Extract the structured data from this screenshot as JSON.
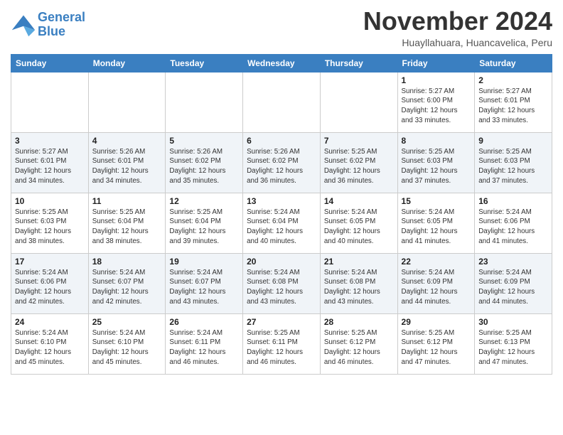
{
  "header": {
    "logo_line1": "General",
    "logo_line2": "Blue",
    "month": "November 2024",
    "location": "Huayllahuara, Huancavelica, Peru"
  },
  "weekdays": [
    "Sunday",
    "Monday",
    "Tuesday",
    "Wednesday",
    "Thursday",
    "Friday",
    "Saturday"
  ],
  "weeks": [
    [
      {
        "day": "",
        "info": ""
      },
      {
        "day": "",
        "info": ""
      },
      {
        "day": "",
        "info": ""
      },
      {
        "day": "",
        "info": ""
      },
      {
        "day": "",
        "info": ""
      },
      {
        "day": "1",
        "info": "Sunrise: 5:27 AM\nSunset: 6:00 PM\nDaylight: 12 hours\nand 33 minutes."
      },
      {
        "day": "2",
        "info": "Sunrise: 5:27 AM\nSunset: 6:01 PM\nDaylight: 12 hours\nand 33 minutes."
      }
    ],
    [
      {
        "day": "3",
        "info": "Sunrise: 5:27 AM\nSunset: 6:01 PM\nDaylight: 12 hours\nand 34 minutes."
      },
      {
        "day": "4",
        "info": "Sunrise: 5:26 AM\nSunset: 6:01 PM\nDaylight: 12 hours\nand 34 minutes."
      },
      {
        "day": "5",
        "info": "Sunrise: 5:26 AM\nSunset: 6:02 PM\nDaylight: 12 hours\nand 35 minutes."
      },
      {
        "day": "6",
        "info": "Sunrise: 5:26 AM\nSunset: 6:02 PM\nDaylight: 12 hours\nand 36 minutes."
      },
      {
        "day": "7",
        "info": "Sunrise: 5:25 AM\nSunset: 6:02 PM\nDaylight: 12 hours\nand 36 minutes."
      },
      {
        "day": "8",
        "info": "Sunrise: 5:25 AM\nSunset: 6:03 PM\nDaylight: 12 hours\nand 37 minutes."
      },
      {
        "day": "9",
        "info": "Sunrise: 5:25 AM\nSunset: 6:03 PM\nDaylight: 12 hours\nand 37 minutes."
      }
    ],
    [
      {
        "day": "10",
        "info": "Sunrise: 5:25 AM\nSunset: 6:03 PM\nDaylight: 12 hours\nand 38 minutes."
      },
      {
        "day": "11",
        "info": "Sunrise: 5:25 AM\nSunset: 6:04 PM\nDaylight: 12 hours\nand 38 minutes."
      },
      {
        "day": "12",
        "info": "Sunrise: 5:25 AM\nSunset: 6:04 PM\nDaylight: 12 hours\nand 39 minutes."
      },
      {
        "day": "13",
        "info": "Sunrise: 5:24 AM\nSunset: 6:04 PM\nDaylight: 12 hours\nand 40 minutes."
      },
      {
        "day": "14",
        "info": "Sunrise: 5:24 AM\nSunset: 6:05 PM\nDaylight: 12 hours\nand 40 minutes."
      },
      {
        "day": "15",
        "info": "Sunrise: 5:24 AM\nSunset: 6:05 PM\nDaylight: 12 hours\nand 41 minutes."
      },
      {
        "day": "16",
        "info": "Sunrise: 5:24 AM\nSunset: 6:06 PM\nDaylight: 12 hours\nand 41 minutes."
      }
    ],
    [
      {
        "day": "17",
        "info": "Sunrise: 5:24 AM\nSunset: 6:06 PM\nDaylight: 12 hours\nand 42 minutes."
      },
      {
        "day": "18",
        "info": "Sunrise: 5:24 AM\nSunset: 6:07 PM\nDaylight: 12 hours\nand 42 minutes."
      },
      {
        "day": "19",
        "info": "Sunrise: 5:24 AM\nSunset: 6:07 PM\nDaylight: 12 hours\nand 43 minutes."
      },
      {
        "day": "20",
        "info": "Sunrise: 5:24 AM\nSunset: 6:08 PM\nDaylight: 12 hours\nand 43 minutes."
      },
      {
        "day": "21",
        "info": "Sunrise: 5:24 AM\nSunset: 6:08 PM\nDaylight: 12 hours\nand 43 minutes."
      },
      {
        "day": "22",
        "info": "Sunrise: 5:24 AM\nSunset: 6:09 PM\nDaylight: 12 hours\nand 44 minutes."
      },
      {
        "day": "23",
        "info": "Sunrise: 5:24 AM\nSunset: 6:09 PM\nDaylight: 12 hours\nand 44 minutes."
      }
    ],
    [
      {
        "day": "24",
        "info": "Sunrise: 5:24 AM\nSunset: 6:10 PM\nDaylight: 12 hours\nand 45 minutes."
      },
      {
        "day": "25",
        "info": "Sunrise: 5:24 AM\nSunset: 6:10 PM\nDaylight: 12 hours\nand 45 minutes."
      },
      {
        "day": "26",
        "info": "Sunrise: 5:24 AM\nSunset: 6:11 PM\nDaylight: 12 hours\nand 46 minutes."
      },
      {
        "day": "27",
        "info": "Sunrise: 5:25 AM\nSunset: 6:11 PM\nDaylight: 12 hours\nand 46 minutes."
      },
      {
        "day": "28",
        "info": "Sunrise: 5:25 AM\nSunset: 6:12 PM\nDaylight: 12 hours\nand 46 minutes."
      },
      {
        "day": "29",
        "info": "Sunrise: 5:25 AM\nSunset: 6:12 PM\nDaylight: 12 hours\nand 47 minutes."
      },
      {
        "day": "30",
        "info": "Sunrise: 5:25 AM\nSunset: 6:13 PM\nDaylight: 12 hours\nand 47 minutes."
      }
    ]
  ]
}
